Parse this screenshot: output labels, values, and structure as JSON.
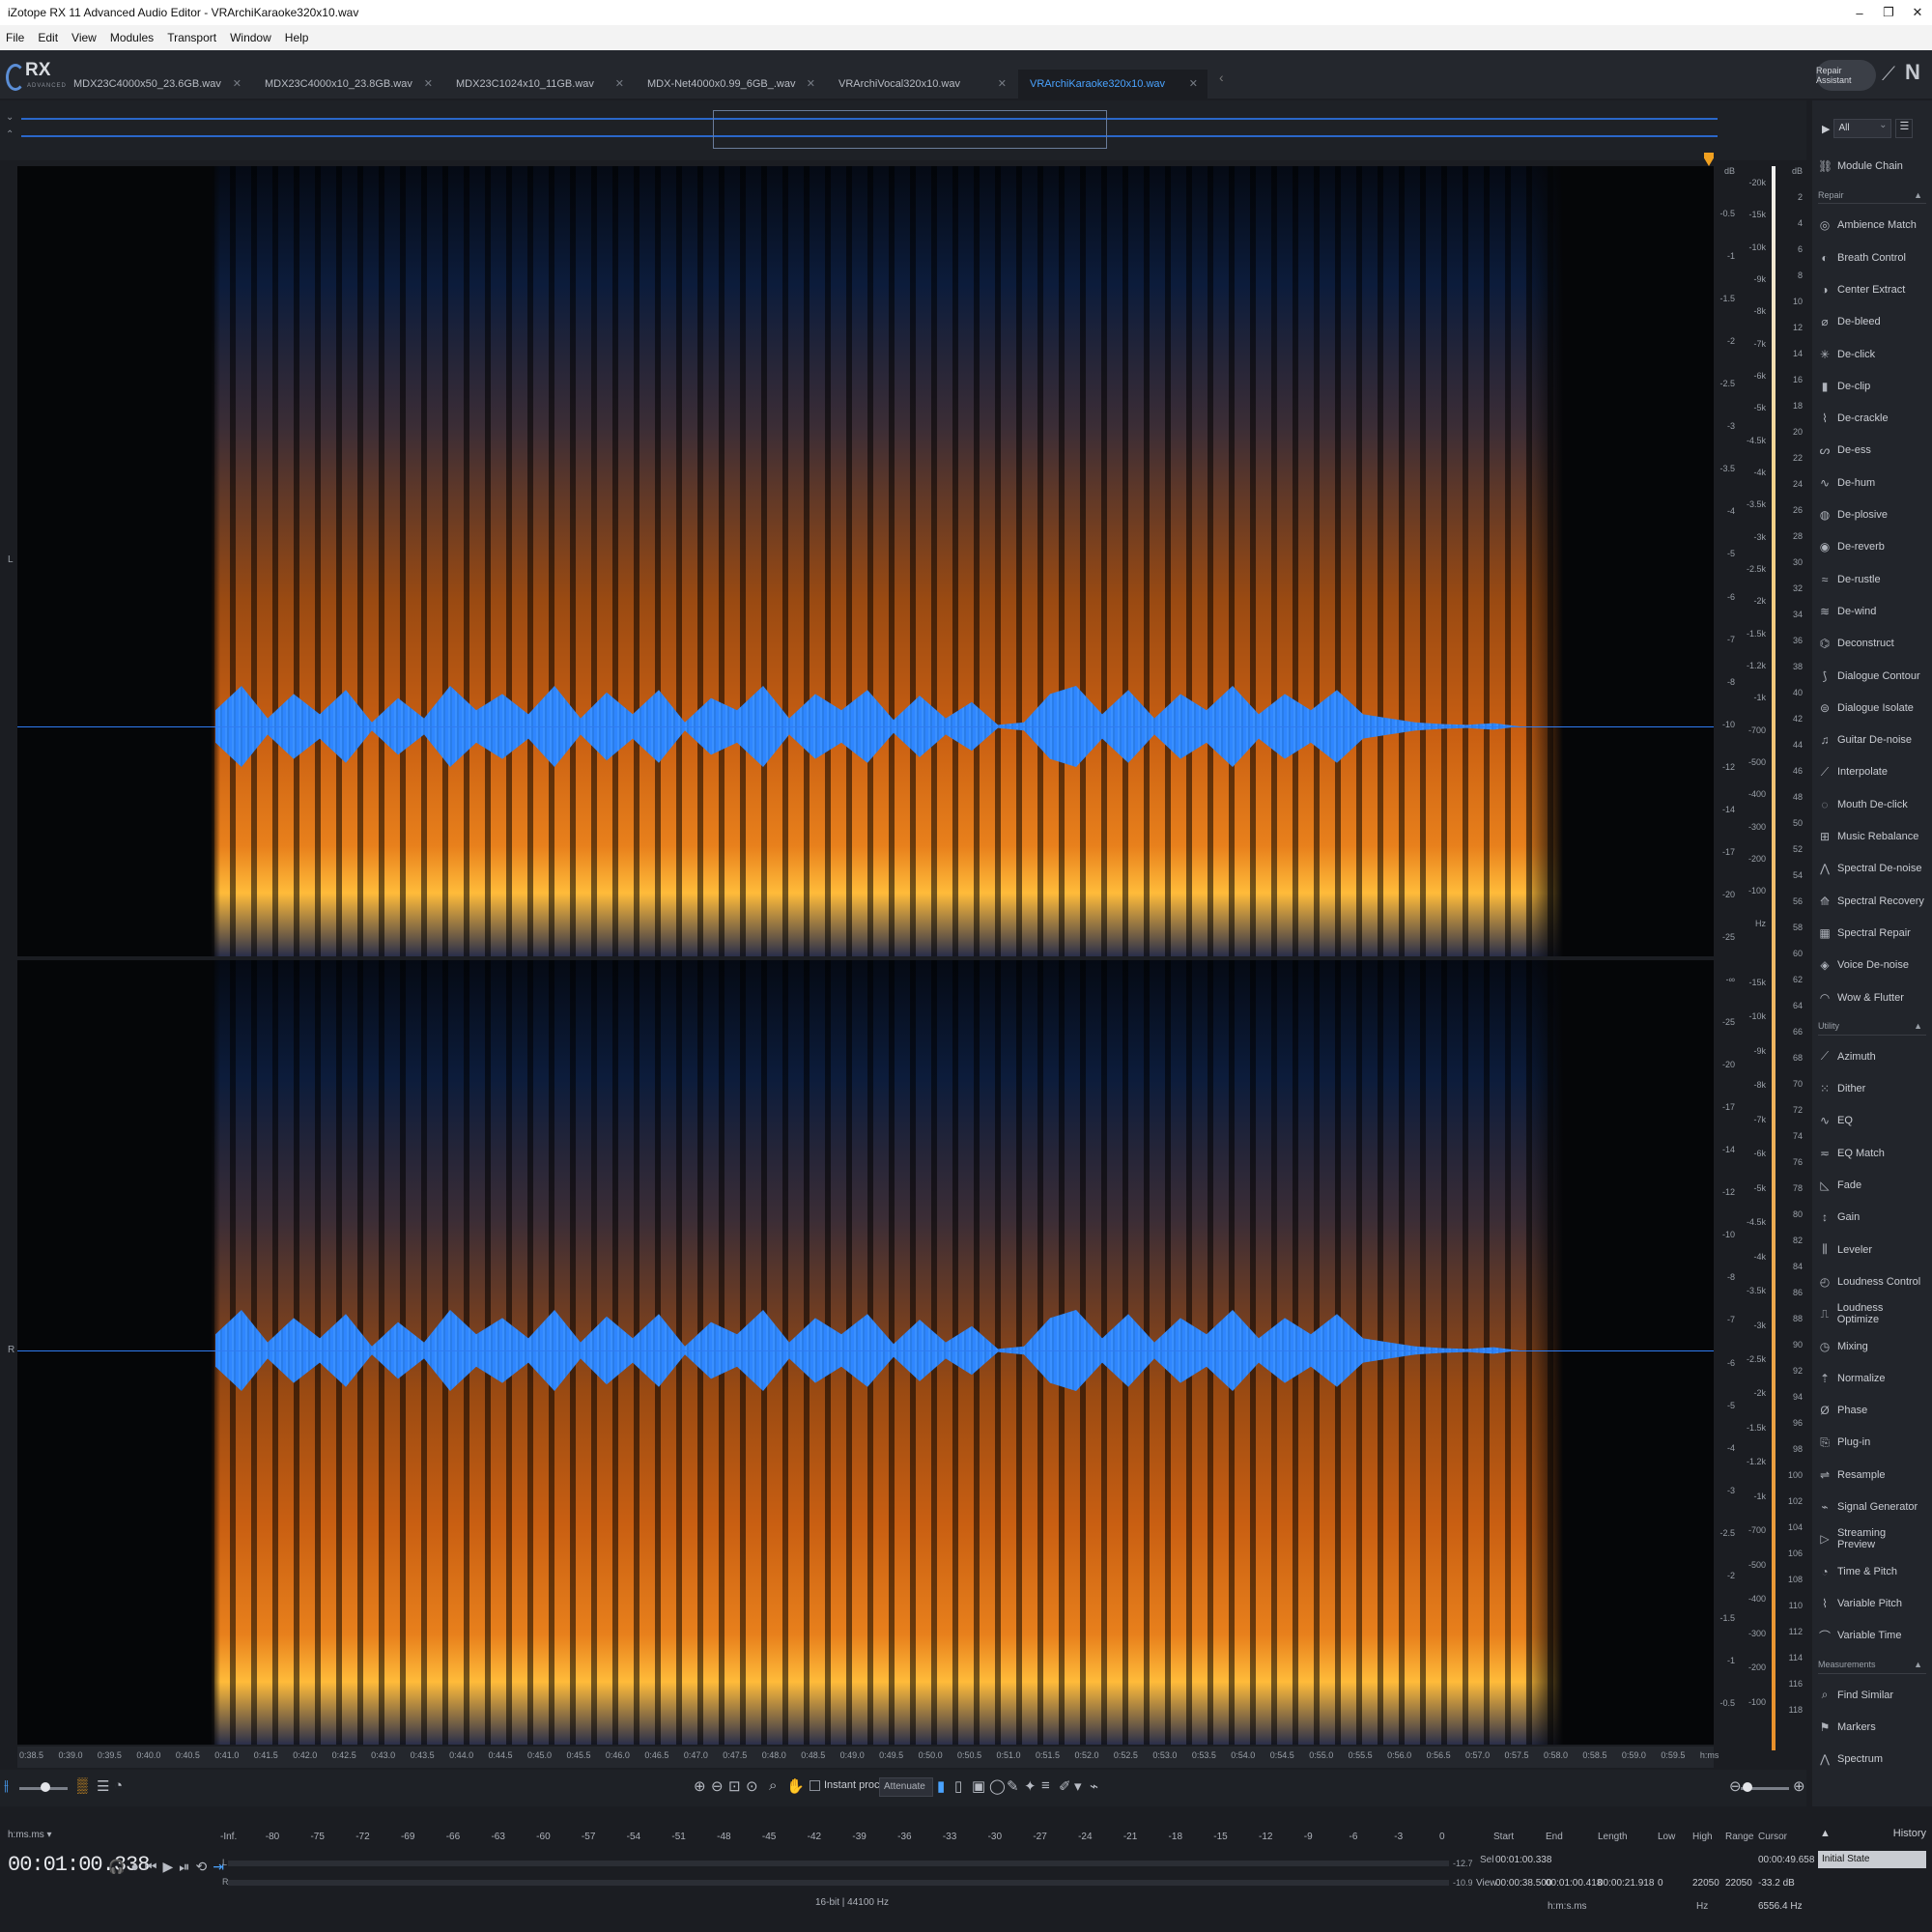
{
  "window": {
    "title": "iZotope RX 11 Advanced Audio Editor - VRArchiKaraoke320x10.wav",
    "minimize": "–",
    "maximize": "❐",
    "close": "✕"
  },
  "menu": [
    "File",
    "Edit",
    "View",
    "Modules",
    "Transport",
    "Window",
    "Help"
  ],
  "logo": {
    "name": "RX",
    "edition": "ADVANCED"
  },
  "tabs": [
    {
      "label": "MDX23C4000x50_23.6GB.wav",
      "active": false
    },
    {
      "label": "MDX23C4000x10_23.8GB.wav",
      "active": false
    },
    {
      "label": "MDX23C1024x10_11GB.wav",
      "active": false
    },
    {
      "label": "MDX-Net4000x0.99_6GB_.wav",
      "active": false
    },
    {
      "label": "VRArchiVocal320x10.wav",
      "active": true,
      "note": ""
    },
    {
      "label": "VRArchiKaraoke320x10.wav",
      "active": true
    }
  ],
  "repair_assistant_label": "Repair Assistant",
  "channels": {
    "left": "L",
    "right": "R"
  },
  "freq_scale": {
    "unit": "Hz",
    "left_db_top": [
      "dB",
      "-0.5",
      "-1",
      "-1.5",
      "-2",
      "-2.5",
      "-3",
      "-3.5",
      "-4",
      "-5",
      "-6",
      "-7",
      "-8",
      "-10",
      "-12",
      "-14",
      "-17",
      "-20",
      "-25",
      "-∞",
      "-25",
      "-20",
      "-17",
      "-14",
      "-12",
      "-10",
      "-8",
      "-7",
      "-6",
      "-5",
      "-4",
      "-3",
      "-2.5",
      "-2",
      "-1.5",
      "-1",
      "-0.5"
    ],
    "hz_top": [
      "-20k",
      "-15k",
      "-10k",
      "-9k",
      "-8k",
      "-7k",
      "-6k",
      "-5k",
      "-4.5k",
      "-4k",
      "-3.5k",
      "-3k",
      "-2.5k",
      "-2k",
      "-1.5k",
      "-1.2k",
      "-1k",
      "-700",
      "-500",
      "-400",
      "-300",
      "-200",
      "-100",
      "Hz"
    ],
    "hz_bottom": [
      "-15k",
      "-10k",
      "-9k",
      "-8k",
      "-7k",
      "-6k",
      "-5k",
      "-4.5k",
      "-4k",
      "-3.5k",
      "-3k",
      "-2.5k",
      "-2k",
      "-1.5k",
      "-1.2k",
      "-1k",
      "-700",
      "-500",
      "-400",
      "-300",
      "-200",
      "-100"
    ]
  },
  "db_meter": [
    "dB",
    "2",
    "4",
    "6",
    "8",
    "10",
    "12",
    "14",
    "16",
    "18",
    "20",
    "22",
    "24",
    "26",
    "28",
    "30",
    "32",
    "34",
    "36",
    "38",
    "40",
    "42",
    "44",
    "46",
    "48",
    "50",
    "52",
    "54",
    "56",
    "58",
    "60",
    "62",
    "64",
    "66",
    "68",
    "70",
    "72",
    "74",
    "76",
    "78",
    "80",
    "82",
    "84",
    "86",
    "88",
    "90",
    "92",
    "94",
    "96",
    "98",
    "100",
    "102",
    "104",
    "106",
    "108",
    "110",
    "112",
    "114",
    "116",
    "118"
  ],
  "time_ruler": [
    "0:38.5",
    "0:39.0",
    "0:39.5",
    "0:40.0",
    "0:40.5",
    "0:41.0",
    "0:41.5",
    "0:42.0",
    "0:42.5",
    "0:43.0",
    "0:43.5",
    "0:44.0",
    "0:44.5",
    "0:45.0",
    "0:45.5",
    "0:46.0",
    "0:46.5",
    "0:47.0",
    "0:47.5",
    "0:48.0",
    "0:48.5",
    "0:49.0",
    "0:49.5",
    "0:50.0",
    "0:50.5",
    "0:51.0",
    "0:51.5",
    "0:52.0",
    "0:52.5",
    "0:53.0",
    "0:53.5",
    "0:54.0",
    "0:54.5",
    "0:55.0",
    "0:55.5",
    "0:56.0",
    "0:56.5",
    "0:57.0",
    "0:57.5",
    "0:58.0",
    "0:58.5",
    "0:59.0",
    "0:59.5",
    "h:ms"
  ],
  "toolbar": {
    "instant_process": "Instant process",
    "attenuate": "Attenuate"
  },
  "module_filter": "All",
  "modules": {
    "module_chain": "Module Chain",
    "repair_header": "Repair",
    "repair": [
      "Ambience Match",
      "Breath Control",
      "Center Extract",
      "De-bleed",
      "De-click",
      "De-clip",
      "De-crackle",
      "De-ess",
      "De-hum",
      "De-plosive",
      "De-reverb",
      "De-rustle",
      "De-wind",
      "Deconstruct",
      "Dialogue Contour",
      "Dialogue Isolate",
      "Guitar De-noise",
      "Interpolate",
      "Mouth De-click",
      "Music Rebalance",
      "Spectral De-noise",
      "Spectral Recovery",
      "Spectral Repair",
      "Voice De-noise",
      "Wow & Flutter"
    ],
    "utility_header": "Utility",
    "utility": [
      "Azimuth",
      "Dither",
      "EQ",
      "EQ Match",
      "Fade",
      "Gain",
      "Leveler",
      "Loudness Control",
      "Loudness Optimize",
      "Mixing",
      "Normalize",
      "Phase",
      "Plug-in",
      "Resample",
      "Signal Generator",
      "Streaming Preview",
      "Time & Pitch",
      "Variable Pitch",
      "Variable Time"
    ],
    "measurements_header": "Measurements",
    "measurements": [
      "Find Similar",
      "Markers",
      "Spectrum"
    ]
  },
  "status": {
    "time_format": "h:ms.ms ▾",
    "time": "00:01:00.338",
    "level_scale": [
      "-Inf.",
      "-80",
      "-75",
      "-72",
      "-69",
      "-66",
      "-63",
      "-60",
      "-57",
      "-54",
      "-51",
      "-48",
      "-45",
      "-42",
      "-39",
      "-36",
      "-33",
      "-30",
      "-27",
      "-24",
      "-21",
      "-18",
      "-15",
      "-12",
      "-9",
      "-6",
      "-3",
      "0"
    ],
    "peak_l": "-12.7",
    "peak_r": "-10.9",
    "format": "16-bit | 44100 Hz",
    "headers": {
      "start": "Start",
      "end": "End",
      "length": "Length",
      "low": "Low",
      "high": "High",
      "range": "Range",
      "cursor": "Cursor"
    },
    "sel": {
      "label": "Sel",
      "start": "00:01:00.338"
    },
    "view": {
      "label": "View",
      "start": "00:00:38.500",
      "end": "00:01:00.418",
      "length": "00:00:21.918",
      "low": "0",
      "high": "22050",
      "range": "22050"
    },
    "cursor_time": "00:00:49.658",
    "cursor_db": "-33.2 dB",
    "cursor_hz": "6556.4 Hz",
    "unit_time": "h:m:s.ms",
    "unit_hz": "Hz"
  },
  "history": {
    "title": "History",
    "items": [
      "Initial State"
    ]
  }
}
